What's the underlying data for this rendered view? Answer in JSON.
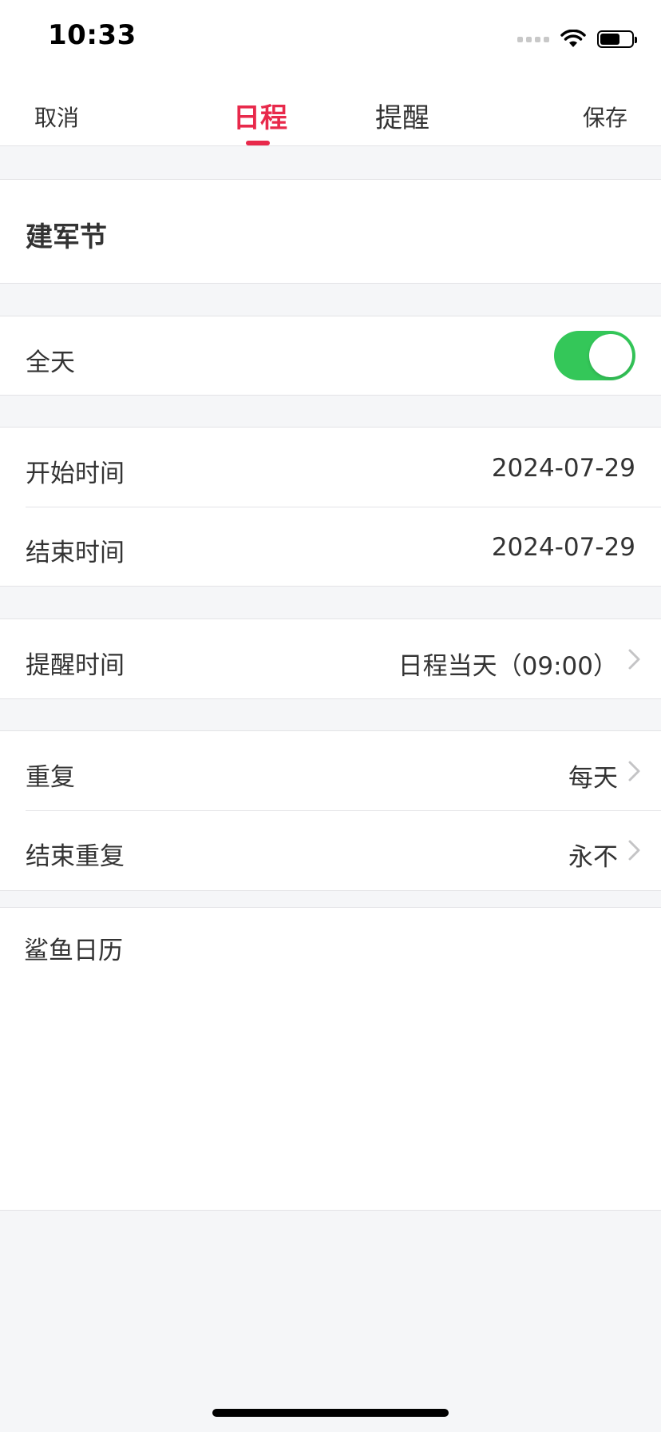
{
  "status_bar": {
    "time": "10:33"
  },
  "nav": {
    "cancel": "取消",
    "save": "保存",
    "tabs": [
      {
        "label": "日程",
        "active": true
      },
      {
        "label": "提醒",
        "active": false
      }
    ],
    "accent_color": "#e8294b"
  },
  "event": {
    "title": "建军节"
  },
  "all_day": {
    "label": "全天",
    "enabled": true,
    "toggle_color": "#34c759"
  },
  "time": {
    "start_label": "开始时间",
    "start_value": "2024-07-29",
    "end_label": "结束时间",
    "end_value": "2024-07-29"
  },
  "alert": {
    "label": "提醒时间",
    "value": "日程当天（09:00）"
  },
  "repeat": {
    "label": "重复",
    "value": "每天",
    "end_label": "结束重复",
    "end_value": "永不"
  },
  "calendar": {
    "name": "鲨鱼日历"
  }
}
